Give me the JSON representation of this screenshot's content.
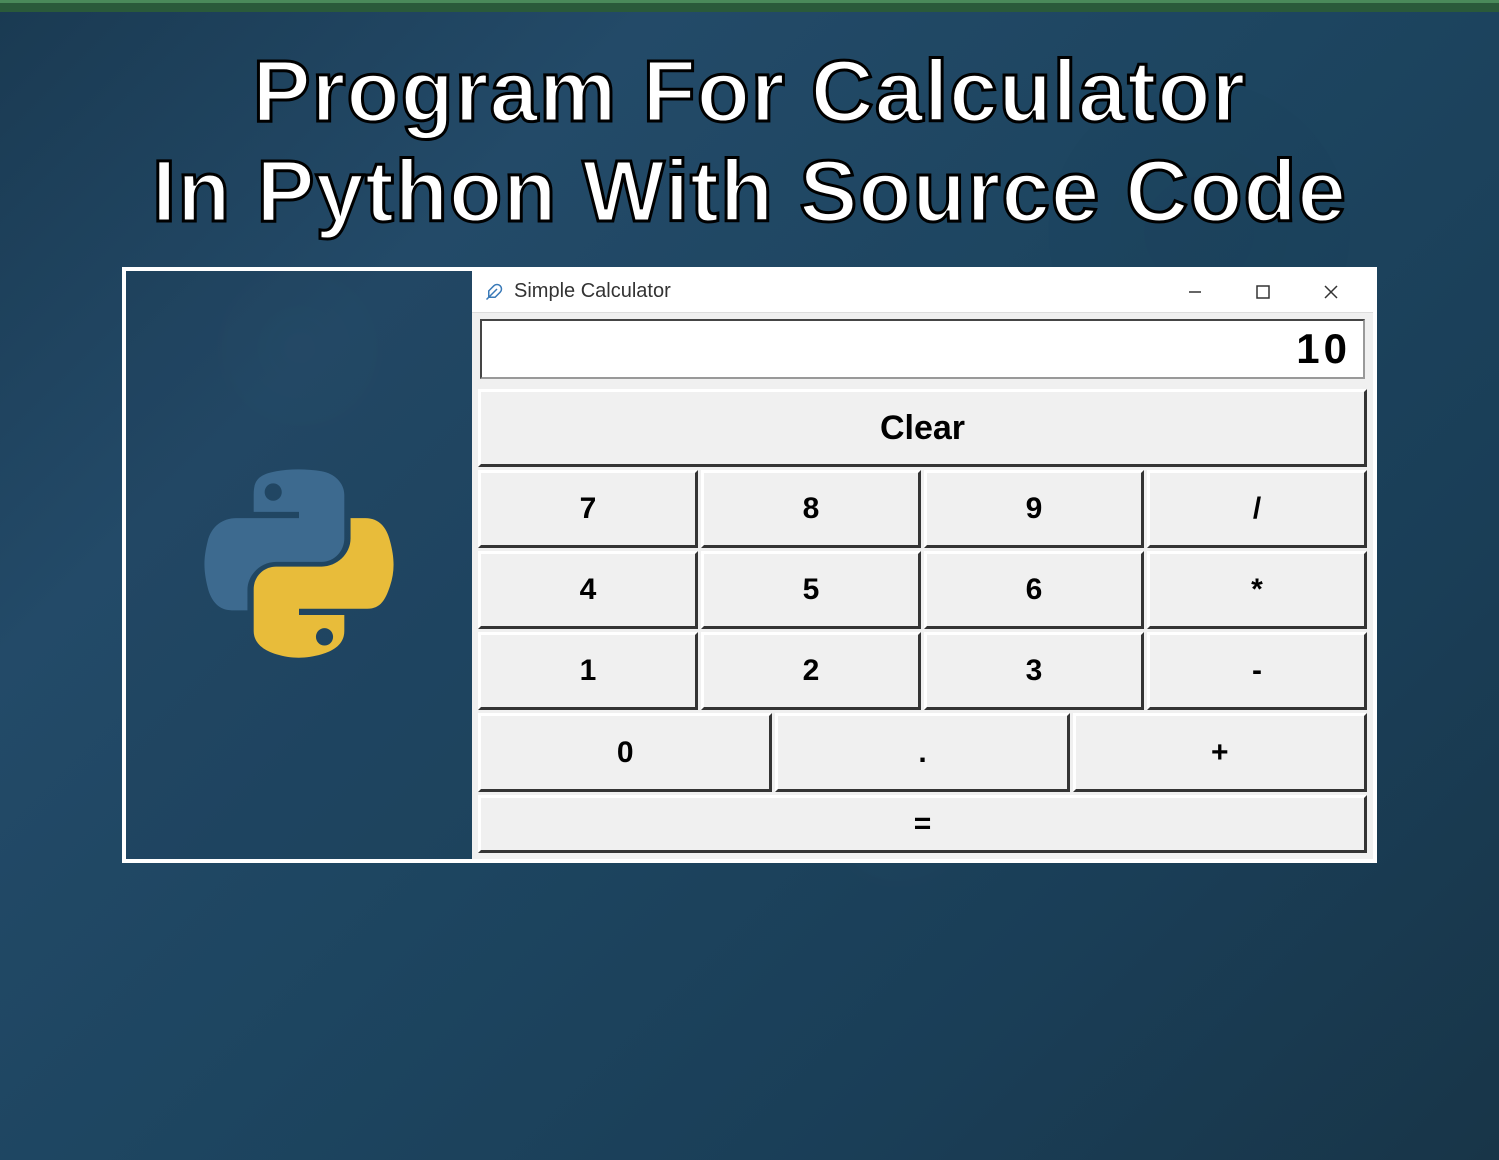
{
  "heading": {
    "line1": "Program For Calculator",
    "line2": "In Python With Source Code"
  },
  "window": {
    "title": "Simple Calculator"
  },
  "calculator": {
    "display_value": "10",
    "clear_label": "Clear",
    "equals_label": "=",
    "buttons": {
      "row1": [
        "7",
        "8",
        "9",
        "/"
      ],
      "row2": [
        "4",
        "5",
        "6",
        "*"
      ],
      "row3": [
        "1",
        "2",
        "3",
        "-"
      ],
      "row4": [
        "0",
        ".",
        "+"
      ]
    }
  }
}
